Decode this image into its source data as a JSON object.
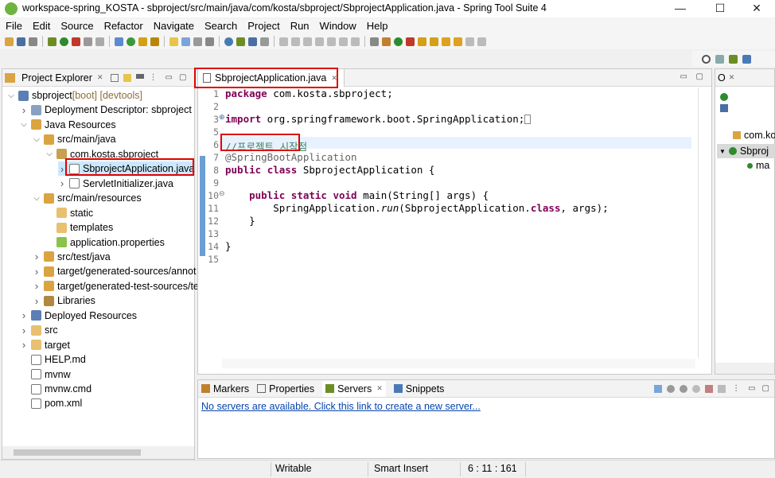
{
  "window": {
    "title": "workspace-spring_KOSTA - sbproject/src/main/java/com/kosta/sbproject/SbprojectApplication.java - Spring Tool Suite 4",
    "minimize": "—",
    "maximize": "☐",
    "close": "✕"
  },
  "menu": [
    "File",
    "Edit",
    "Source",
    "Refactor",
    "Navigate",
    "Search",
    "Project",
    "Run",
    "Window",
    "Help"
  ],
  "explorer": {
    "tab_label": "Project Explorer",
    "close": "✕",
    "tree": [
      {
        "label": "sbproject",
        "extra": " [boot] [devtools]",
        "depth": 0,
        "expanded": true,
        "icon": "project-icon"
      },
      {
        "label": "Deployment Descriptor: sbproject",
        "depth": 1,
        "expanded": false,
        "icon": "descriptor-icon"
      },
      {
        "label": "Java Resources",
        "depth": 1,
        "expanded": true,
        "icon": "java-resources-icon"
      },
      {
        "label": "src/main/java",
        "depth": 2,
        "expanded": true,
        "icon": "source-folder-icon"
      },
      {
        "label": "com.kosta.sbproject",
        "depth": 3,
        "expanded": true,
        "icon": "package-icon"
      },
      {
        "label": "SbprojectApplication.java",
        "depth": 4,
        "expanded": false,
        "icon": "java-file-icon",
        "selected": true
      },
      {
        "label": "ServletInitializer.java",
        "depth": 4,
        "expanded": false,
        "icon": "java-file-icon"
      },
      {
        "label": "src/main/resources",
        "depth": 2,
        "expanded": true,
        "icon": "source-folder-icon"
      },
      {
        "label": "static",
        "depth": 3,
        "leaf": true,
        "icon": "folder-icon"
      },
      {
        "label": "templates",
        "depth": 3,
        "leaf": true,
        "icon": "folder-icon"
      },
      {
        "label": "application.properties",
        "depth": 3,
        "leaf": true,
        "icon": "properties-icon"
      },
      {
        "label": "src/test/java",
        "depth": 2,
        "expanded": false,
        "icon": "source-folder-icon"
      },
      {
        "label": "target/generated-sources/annot",
        "depth": 2,
        "expanded": false,
        "icon": "source-folder-icon"
      },
      {
        "label": "target/generated-test-sources/te",
        "depth": 2,
        "expanded": false,
        "icon": "source-folder-icon"
      },
      {
        "label": "Libraries",
        "depth": 2,
        "expanded": false,
        "icon": "library-icon"
      },
      {
        "label": "Deployed Resources",
        "depth": 1,
        "expanded": false,
        "icon": "deployed-icon"
      },
      {
        "label": "src",
        "depth": 1,
        "expanded": false,
        "icon": "folder-icon"
      },
      {
        "label": "target",
        "depth": 1,
        "expanded": false,
        "icon": "folder-icon"
      },
      {
        "label": "HELP.md",
        "depth": 1,
        "leaf": true,
        "icon": "file-icon"
      },
      {
        "label": "mvnw",
        "depth": 1,
        "leaf": true,
        "icon": "file-icon"
      },
      {
        "label": "mvnw.cmd",
        "depth": 1,
        "leaf": true,
        "icon": "file-icon"
      },
      {
        "label": "pom.xml",
        "depth": 1,
        "leaf": true,
        "icon": "xml-file-icon"
      }
    ]
  },
  "editor": {
    "tab_label": "SbprojectApplication.java",
    "tab_close": "✕",
    "line_numbers": [
      "1",
      "2",
      "3",
      "5",
      "6",
      "7",
      "8",
      "9",
      "10",
      "11",
      "12",
      "13",
      "14",
      "15"
    ],
    "line_markers": {
      "3": "⊕",
      "10": "⊖"
    },
    "lines": {
      "l1": {
        "kw": "package",
        "rest": " com.kosta.sbproject;"
      },
      "l3": {
        "kw": "import",
        "rest": " org.springframework.boot.SpringApplication;"
      },
      "l6": {
        "comment": "//프로젝트 시작점"
      },
      "l7": {
        "annotation": "@SpringBootApplication"
      },
      "l8": {
        "kw1": "public",
        "kw2": "class",
        "rest": " SbprojectApplication {"
      },
      "l10": {
        "kw1": "public",
        "kw2": "static",
        "kw3": "void",
        "rest": " main(String[] args) {"
      },
      "l11": {
        "a": "SpringApplication.",
        "b": "run",
        "c": "(SbprojectApplication.",
        "d": "class",
        "e": ", args);"
      },
      "l12": {
        "text": "}"
      },
      "l14": {
        "text": "}"
      }
    }
  },
  "outline": {
    "tab_label": "O",
    "items": [
      "com.ko",
      "Sbproj",
      "ma"
    ]
  },
  "bottom": {
    "tabs": [
      "Markers",
      "Properties",
      "Servers",
      "Snippets"
    ],
    "active_tab_close": "✕",
    "servers_link": "No servers are available. Click this link to create a new server..."
  },
  "status": {
    "writable": "Writable",
    "insert_mode": "Smart Insert",
    "position": "6 : 11 : 161"
  },
  "colors": {
    "spring_green": "#6db33f",
    "keyword": "#7f0055",
    "comment": "#3f7f5f",
    "link": "#0645ad",
    "highlight_box": "#e00000"
  }
}
